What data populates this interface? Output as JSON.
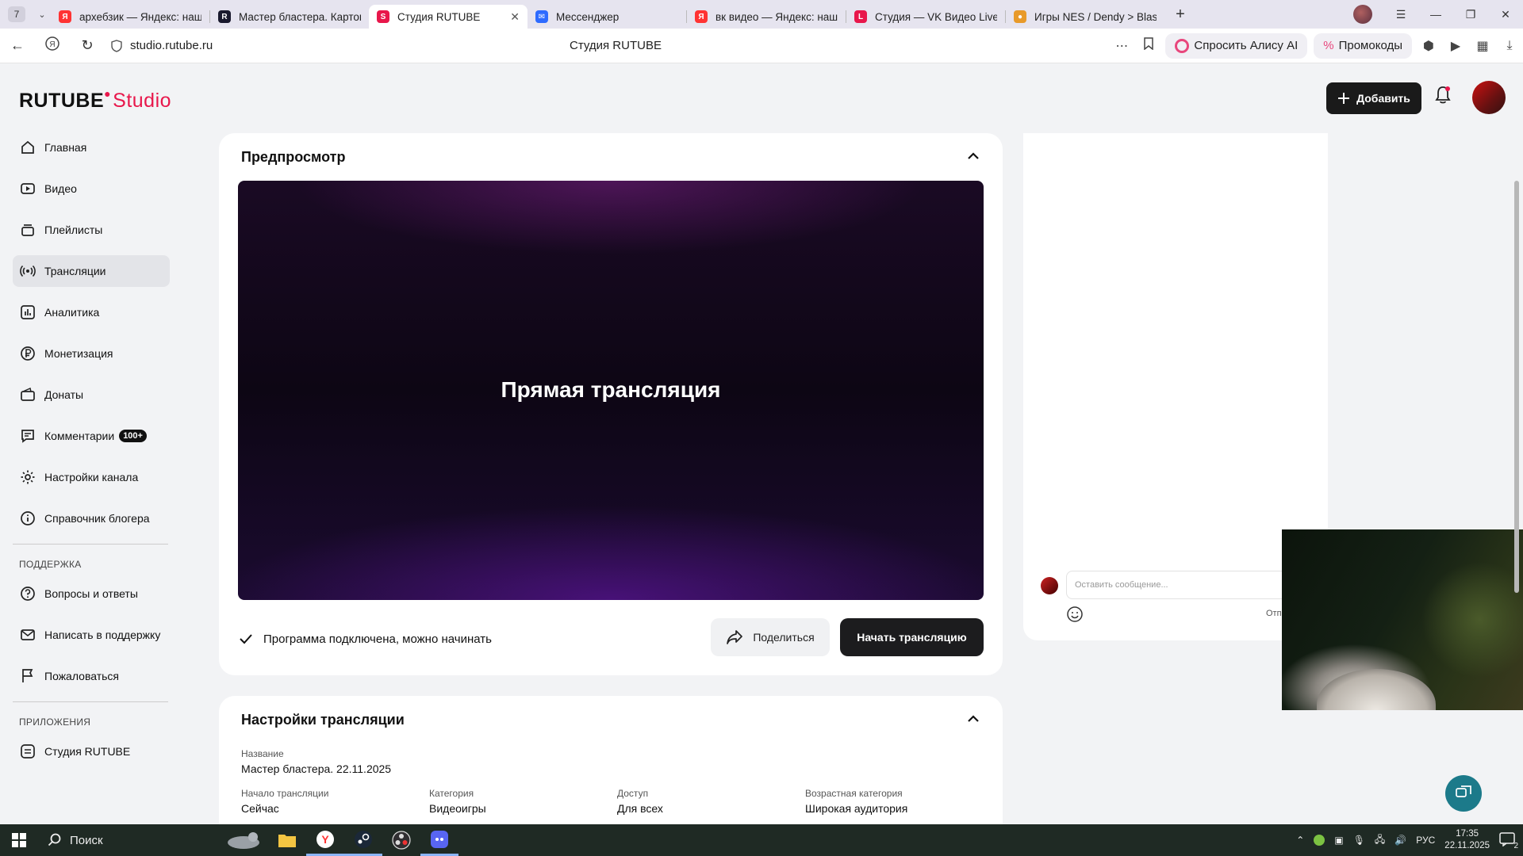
{
  "browser": {
    "tab_count": "7",
    "tabs": [
      {
        "title": "архебзик — Яндекс: наш",
        "color": "#f33",
        "glyph": "Я"
      },
      {
        "title": "Мастер бластера. Картон",
        "color": "#1a1a2e",
        "glyph": "R"
      },
      {
        "title": "Студия RUTUBE",
        "color": "#e8174b",
        "glyph": "S"
      },
      {
        "title": "Мессенджер",
        "color": "#2e6bff",
        "glyph": "✉"
      },
      {
        "title": "вк видео — Яндекс: наш",
        "color": "#f33",
        "glyph": "Я"
      },
      {
        "title": "Студия — VK Видео Live",
        "color": "#e8174b",
        "glyph": "L"
      },
      {
        "title": "Игры NES / Dendy > Blast",
        "color": "#e89a2a",
        "glyph": "●"
      }
    ],
    "url": "studio.rutube.ru",
    "page_title": "Студия RUTUBE",
    "alisa_label": "Спросить Алису AI",
    "promo_label": "Промокоды"
  },
  "header": {
    "logo_main": "RUTUBE",
    "logo_sub": "Studio",
    "add_label": "Добавить"
  },
  "sidebar": {
    "items": [
      {
        "label": "Главная",
        "icon": "home-icon"
      },
      {
        "label": "Видео",
        "icon": "video-icon"
      },
      {
        "label": "Плейлисты",
        "icon": "playlist-icon"
      },
      {
        "label": "Трансляции",
        "icon": "broadcast-icon"
      },
      {
        "label": "Аналитика",
        "icon": "analytics-icon"
      },
      {
        "label": "Монетизация",
        "icon": "ruble-icon"
      },
      {
        "label": "Донаты",
        "icon": "wallet-icon"
      },
      {
        "label": "Комментарии",
        "icon": "comment-icon",
        "badge": "100+"
      },
      {
        "label": "Настройки канала",
        "icon": "gear-icon"
      },
      {
        "label": "Справочник блогера",
        "icon": "info-icon"
      }
    ],
    "support_heading": "ПОДДЕРЖКА",
    "support_items": [
      {
        "label": "Вопросы и ответы",
        "icon": "question-icon"
      },
      {
        "label": "Написать в поддержку",
        "icon": "mail-icon"
      },
      {
        "label": "Пожаловаться",
        "icon": "flag-icon"
      }
    ],
    "apps_heading": "ПРИЛОЖЕНИЯ",
    "apps_items": [
      {
        "label": "Студия RUTUBE",
        "icon": "studio-icon"
      }
    ]
  },
  "preview": {
    "title": "Предпросмотр",
    "player_label": "Прямая трансляция",
    "status_text": "Программа подключена, можно начинать",
    "share_label": "Поделиться",
    "start_label": "Начать трансляцию"
  },
  "settings": {
    "title": "Настройки трансляции",
    "name_label": "Название",
    "name_value": "Мастер бластера. 22.11.2025",
    "fields": [
      {
        "label": "Начало трансляции",
        "value": "Сейчас"
      },
      {
        "label": "Категория",
        "value": "Видеоигры"
      },
      {
        "label": "Доступ",
        "value": "Для всех"
      },
      {
        "label": "Возрастная категория",
        "value": "Широкая аудитория"
      }
    ]
  },
  "chat": {
    "input_placeholder": "Оставить сообщение...",
    "send_label": "Отп"
  },
  "taskbar": {
    "search_label": "Поиск",
    "lang": "РУС",
    "time": "17:35",
    "date": "22.11.2025",
    "notif_count": "2"
  },
  "colors": {
    "accent": "#e8174b",
    "dark_button": "#1c1c1e",
    "active_sidebar": "#e3e4e8"
  }
}
